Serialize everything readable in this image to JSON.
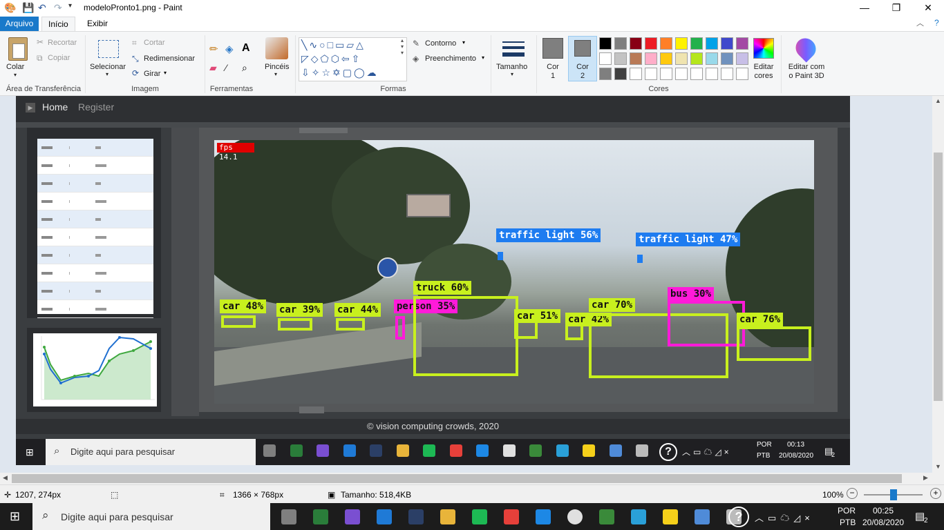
{
  "titlebar": {
    "title": "modeloPronto1.png - Paint",
    "min": "—",
    "max": "❐",
    "close": "✕"
  },
  "tabs": {
    "file": "Arquivo",
    "home": "Início",
    "view": "Exibir"
  },
  "clipboard": {
    "paste": "Colar",
    "cut": "Recortar",
    "copy": "Copiar",
    "label": "Área de Transferência"
  },
  "image": {
    "select": "Selecionar",
    "crop": "Cortar",
    "resize": "Redimensionar",
    "rotate": "Girar",
    "label": "Imagem"
  },
  "tools": {
    "label": "Ferramentas",
    "brushes": "Pincéis"
  },
  "shapes": {
    "outline": "Contorno",
    "fill": "Preenchimento",
    "label": "Formas"
  },
  "size": {
    "label": "Tamanho"
  },
  "colors": {
    "color1": "Cor 1",
    "color2": "Cor 2",
    "label": "Cores",
    "edit": "Editar cores",
    "paint3d": "Editar com o Paint 3D",
    "palette_row1": [
      "#000000",
      "#7f7f7f",
      "#880015",
      "#ed1c24",
      "#ff7f27",
      "#fff200",
      "#22b14c",
      "#00a2e8",
      "#3f48cc",
      "#a349a4"
    ],
    "palette_row2": [
      "#ffffff",
      "#c3c3c3",
      "#b97a57",
      "#ffaec9",
      "#ffc90e",
      "#efe4b0",
      "#b5e61d",
      "#99d9ea",
      "#7092be",
      "#c8bfe7"
    ],
    "palette_row3": [
      "#7f7f7f",
      "#404040",
      "#ffffff",
      "#ffffff",
      "#ffffff",
      "#ffffff",
      "#ffffff",
      "#ffffff",
      "#ffffff",
      "#ffffff"
    ]
  },
  "screenshot": {
    "nav_home": "Home",
    "nav_register": "Register",
    "fps": "fps 14.1",
    "footer": "© vision computing   crowds, 2020",
    "detections": [
      {
        "label": "car 48%",
        "color": "#c8f01e"
      },
      {
        "label": "car 39%",
        "color": "#c8f01e"
      },
      {
        "label": "car 44%",
        "color": "#c8f01e"
      },
      {
        "label": "person 35%",
        "color": "#ff1ad9"
      },
      {
        "label": "truck 60%",
        "color": "#c8f01e"
      },
      {
        "label": "car 51%",
        "color": "#c8f01e"
      },
      {
        "label": "car 42%",
        "color": "#c8f01e"
      },
      {
        "label": "car 70%",
        "color": "#c8f01e"
      },
      {
        "label": "bus 30%",
        "color": "#ff1ad9"
      },
      {
        "label": "car 76%",
        "color": "#c8f01e"
      },
      {
        "label": "traffic light 56%",
        "color": "#1e7cf0"
      },
      {
        "label": "traffic light 47%",
        "color": "#1e7cf0"
      }
    ],
    "inner_taskbar": {
      "search": "Digite aqui para pesquisar",
      "lang1": "POR",
      "lang2": "PTB",
      "time": "00:13",
      "date": "20/08/2020",
      "notif": "2"
    }
  },
  "status": {
    "cursor": "1207, 274px",
    "dimensions": "1366 × 768px",
    "filesize": "Tamanho: 518,4KB",
    "zoom": "100%"
  },
  "taskbar": {
    "search": "Digite aqui para pesquisar",
    "lang1": "POR",
    "lang2": "PTB",
    "time": "00:25",
    "date": "20/08/2020",
    "notif": "2"
  }
}
